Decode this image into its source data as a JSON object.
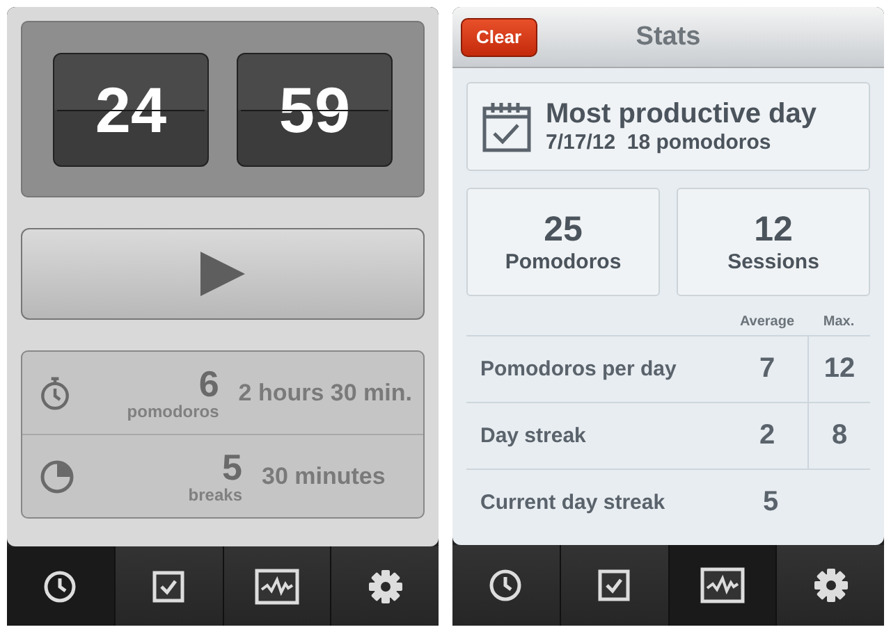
{
  "timer_screen": {
    "minutes": "24",
    "seconds": "59",
    "summary": [
      {
        "kind": "pomodoros",
        "count": "6",
        "unit": "pomodoros",
        "duration": "2 hours 30 min."
      },
      {
        "kind": "breaks",
        "count": "5",
        "unit": "breaks",
        "duration": "30 minutes"
      }
    ],
    "tab_bar": [
      {
        "kind": "clock",
        "selected": true
      },
      {
        "kind": "tasks",
        "selected": false
      },
      {
        "kind": "stats",
        "selected": false
      },
      {
        "kind": "settings",
        "selected": false
      }
    ]
  },
  "stats_screen": {
    "clear_button": "Clear",
    "title": "Stats",
    "best_day": {
      "heading": "Most productive day",
      "date": "7/17/12",
      "detail": "18 pomodoros"
    },
    "totals": [
      {
        "value": "25",
        "label": "Pomodoros"
      },
      {
        "value": "12",
        "label": "Sessions"
      }
    ],
    "columns": [
      "Average",
      "Max."
    ],
    "rows": [
      {
        "label": "Pomodoros per day",
        "average": "7",
        "max": "12"
      },
      {
        "label": "Day streak",
        "average": "2",
        "max": "8"
      },
      {
        "label": "Current day streak",
        "value": "5"
      }
    ],
    "tab_bar": [
      {
        "kind": "clock",
        "selected": false
      },
      {
        "kind": "tasks",
        "selected": false
      },
      {
        "kind": "stats",
        "selected": true
      },
      {
        "kind": "settings",
        "selected": false
      }
    ]
  }
}
